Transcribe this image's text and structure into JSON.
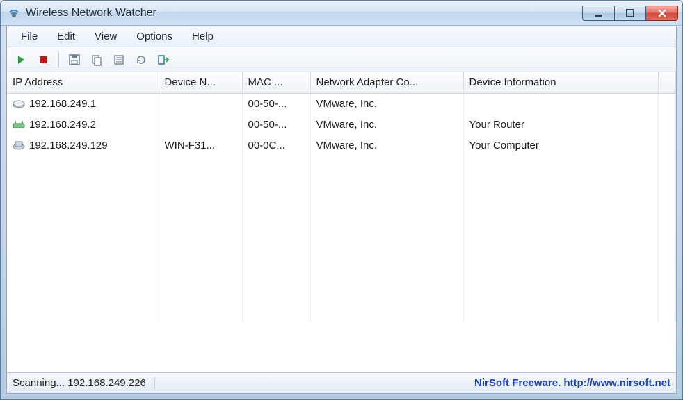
{
  "window": {
    "title": "Wireless Network Watcher"
  },
  "menubar": {
    "items": [
      "File",
      "Edit",
      "View",
      "Options",
      "Help"
    ]
  },
  "toolbar": {
    "icons": [
      "play-icon",
      "stop-icon",
      "save-icon",
      "copy-icon",
      "properties-icon",
      "refresh-icon",
      "exit-icon"
    ]
  },
  "columns": {
    "c0": "IP Address",
    "c1": "Device N...",
    "c2": "MAC ...",
    "c3": "Network Adapter Co...",
    "c4": "Device Information"
  },
  "rows": [
    {
      "icon": "device-generic-icon",
      "ip": "192.168.249.1",
      "name": "",
      "mac": "00-50-...",
      "adapter": "VMware, Inc.",
      "info": ""
    },
    {
      "icon": "device-router-icon",
      "ip": "192.168.249.2",
      "name": "",
      "mac": "00-50-...",
      "adapter": "VMware, Inc.",
      "info": "Your Router"
    },
    {
      "icon": "device-computer-icon",
      "ip": "192.168.249.129",
      "name": "WIN-F31...",
      "mac": "00-0C...",
      "adapter": "VMware, Inc.",
      "info": "Your Computer"
    }
  ],
  "statusbar": {
    "left": "Scanning... 192.168.249.226",
    "right": "NirSoft Freeware.  http://www.nirsoft.net"
  }
}
